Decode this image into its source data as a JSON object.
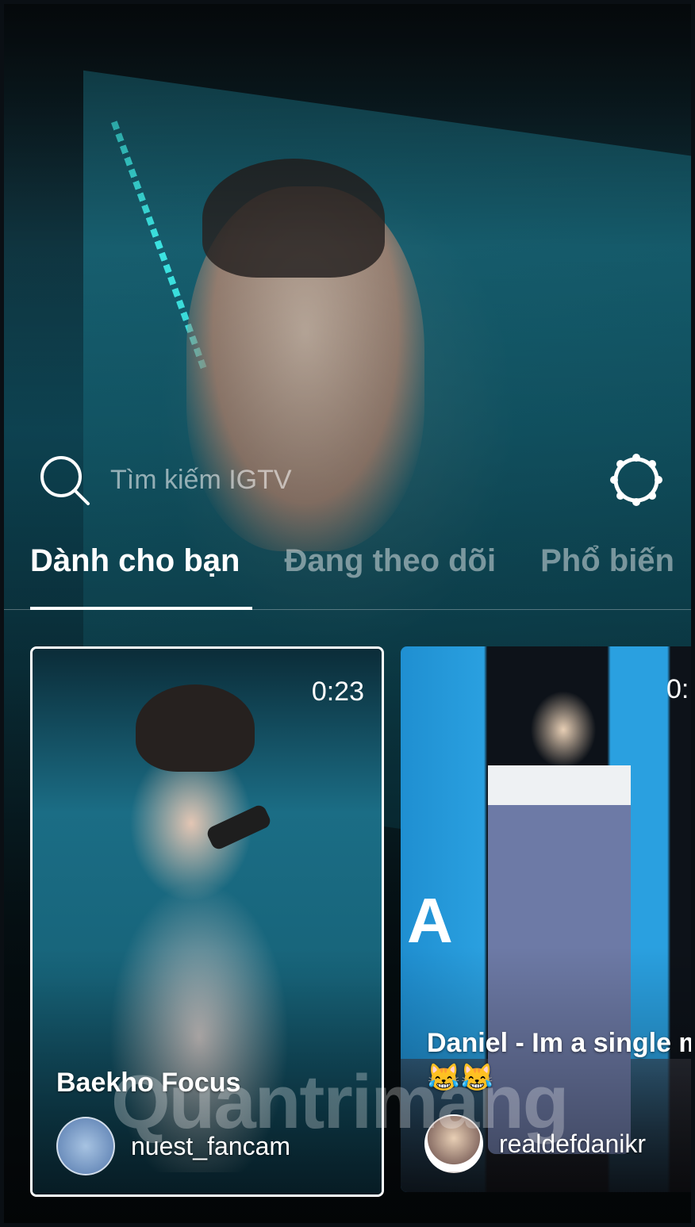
{
  "search": {
    "placeholder": "Tìm kiếm IGTV"
  },
  "tabs": [
    {
      "label": "Dành cho bạn"
    },
    {
      "label": "Đang theo dõi"
    },
    {
      "label": "Phổ biến"
    }
  ],
  "videos": [
    {
      "duration": "0:23",
      "title": "Baekho Focus",
      "author": "nuest_fancam"
    },
    {
      "duration": "0:",
      "title": "Daniel - Im a single man 😹😹",
      "author": "realdefdanikr"
    }
  ],
  "watermark": {
    "text": "Quantrimang"
  },
  "colors": {
    "accent": "#3ff0ee",
    "tab_active": "#ffffff"
  }
}
